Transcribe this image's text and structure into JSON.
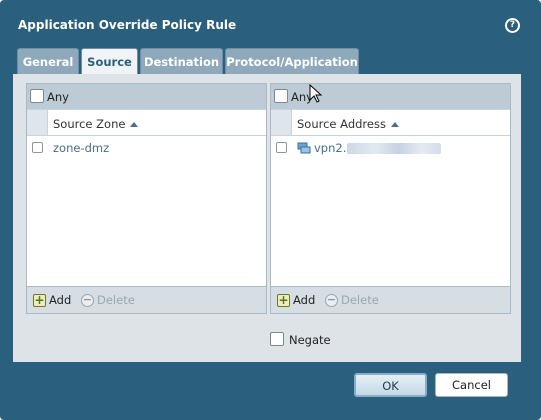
{
  "dialog": {
    "title": "Application Override Policy Rule"
  },
  "tabs": [
    {
      "label": "General"
    },
    {
      "label": "Source"
    },
    {
      "label": "Destination"
    },
    {
      "label": "Protocol/Application"
    }
  ],
  "active_tab": "Source",
  "left_panel": {
    "any_label": "Any",
    "column_header": "Source Zone",
    "rows": [
      {
        "value": "zone-dmz"
      }
    ],
    "add_label": "Add",
    "delete_label": "Delete"
  },
  "right_panel": {
    "any_label": "Any",
    "column_header": "Source Address",
    "rows": [
      {
        "value": "vpn2."
      }
    ],
    "add_label": "Add",
    "delete_label": "Delete"
  },
  "negate_label": "Negate",
  "buttons": {
    "ok": "OK",
    "cancel": "Cancel"
  },
  "colors": {
    "frame": "#2a5f7e",
    "tab_inactive": "#8fa9bc",
    "link_text": "#4a6e86"
  }
}
